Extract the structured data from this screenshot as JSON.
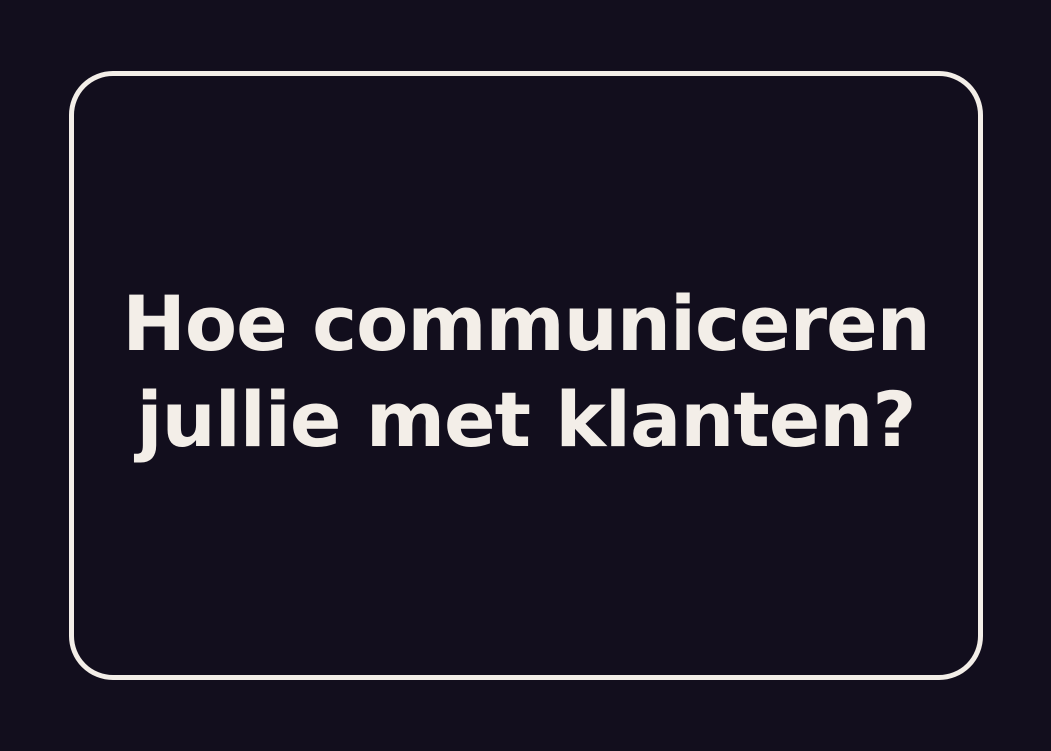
{
  "card": {
    "question_line1": "Hoe communiceren",
    "question_line2": "jullie met klanten?"
  },
  "colors": {
    "background": "#120e1d",
    "foreground": "#f3eee8"
  }
}
